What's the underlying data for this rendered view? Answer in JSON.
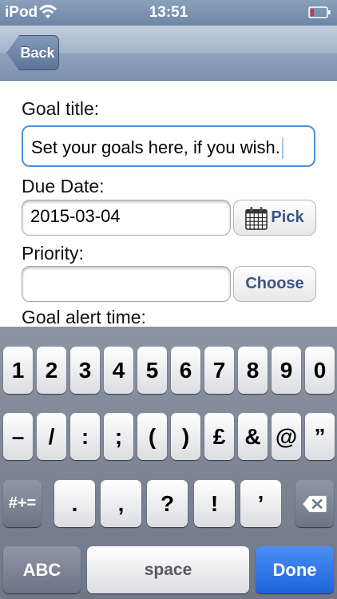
{
  "status_bar": {
    "carrier": "iPod",
    "time": "13:51",
    "wifi_icon": "wifi-icon",
    "battery_icon": "battery-low-icon",
    "battery_color": "#e03232"
  },
  "nav": {
    "back_label": "Back"
  },
  "form": {
    "goal_title_label": "Goal title:",
    "goal_title_value": "Set your goals here, if you wish.",
    "due_date_label": "Due Date:",
    "due_date_value": "2015-03-04",
    "pick_label": "Pick",
    "pick_icon": "calendar-icon",
    "priority_label": "Priority:",
    "priority_value": "",
    "choose_label": "Choose",
    "alert_time_label": "Goal alert time:"
  },
  "keyboard": {
    "row1": [
      "1",
      "2",
      "3",
      "4",
      "5",
      "6",
      "7",
      "8",
      "9",
      "0"
    ],
    "row2": [
      "–",
      "/",
      ":",
      ";",
      "(",
      ")",
      "£",
      "&",
      "@",
      "”"
    ],
    "row3": [
      "#+=",
      ".",
      ",",
      "?",
      "!",
      "’"
    ],
    "delete_icon": "backspace-icon",
    "abc_label": "ABC",
    "space_label": "space",
    "done_label": "Done",
    "done_color": "#2b6fe6"
  }
}
